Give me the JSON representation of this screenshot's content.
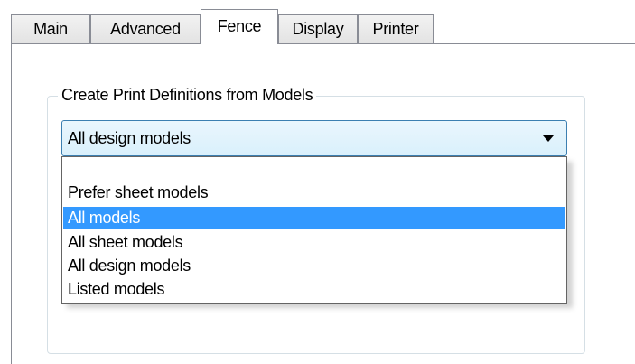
{
  "tabs": [
    {
      "label": "Main",
      "active": false
    },
    {
      "label": "Advanced",
      "active": false
    },
    {
      "label": "Fence",
      "active": true
    },
    {
      "label": "Display",
      "active": false
    },
    {
      "label": "Printer",
      "active": false
    }
  ],
  "group": {
    "title": "Create Print Definitions from Models"
  },
  "combo": {
    "value": "All design models",
    "options": [
      {
        "label": "Prefer sheet models",
        "highlighted": false
      },
      {
        "label": "All models",
        "highlighted": true
      },
      {
        "label": "All sheet models",
        "highlighted": false
      },
      {
        "label": "All design models",
        "highlighted": false
      },
      {
        "label": "Listed models",
        "highlighted": false
      }
    ]
  },
  "colors": {
    "highlight": "#3399ff",
    "tab_border": "#898c95",
    "combo_border": "#3c7fb1"
  }
}
